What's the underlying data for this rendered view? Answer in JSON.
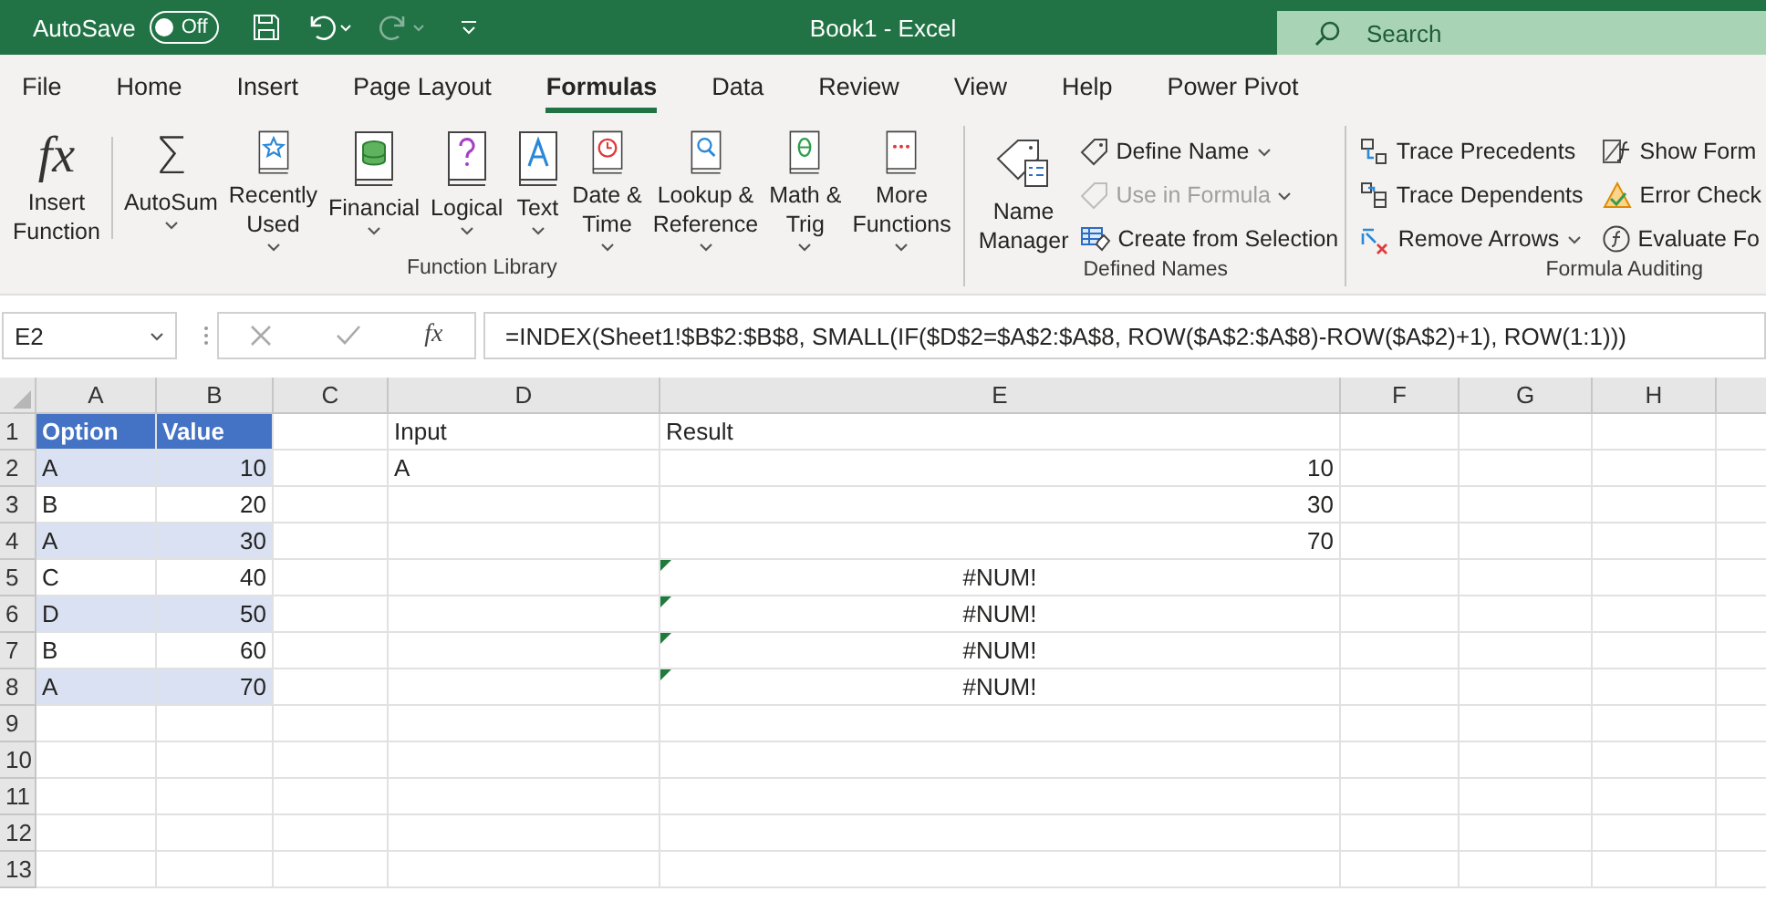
{
  "window": {
    "autosave_label": "AutoSave",
    "autosave_toggle": {
      "label": "Off",
      "on": false
    },
    "title": "Book1  -  Excel",
    "search": {
      "placeholder": "Search"
    }
  },
  "tabs": [
    {
      "label": "File",
      "selected": false
    },
    {
      "label": "Home",
      "selected": false
    },
    {
      "label": "Insert",
      "selected": false
    },
    {
      "label": "Page Layout",
      "selected": false
    },
    {
      "label": "Formulas",
      "selected": true
    },
    {
      "label": "Data",
      "selected": false
    },
    {
      "label": "Review",
      "selected": false
    },
    {
      "label": "View",
      "selected": false
    },
    {
      "label": "Help",
      "selected": false
    },
    {
      "label": "Power Pivot",
      "selected": false
    }
  ],
  "ribbon": {
    "function_library": {
      "label": "Function Library",
      "insert_function": {
        "glyph": "fx",
        "lines": [
          "Insert",
          "Function"
        ]
      },
      "buttons": [
        {
          "glyph": "Σ",
          "lines": [
            "AutoSum"
          ],
          "dropdown": true
        },
        {
          "lines": [
            "Recently",
            "Used"
          ],
          "dropdown": true
        },
        {
          "lines": [
            "Financial"
          ],
          "dropdown": true
        },
        {
          "lines": [
            "Logical"
          ],
          "dropdown": true
        },
        {
          "lines": [
            "Text"
          ],
          "dropdown": true
        },
        {
          "lines": [
            "Date &",
            "Time"
          ],
          "dropdown": true
        },
        {
          "lines": [
            "Lookup &",
            "Reference"
          ],
          "dropdown": true
        },
        {
          "lines": [
            "Math &",
            "Trig"
          ],
          "dropdown": true
        },
        {
          "lines": [
            "More",
            "Functions"
          ],
          "dropdown": true
        }
      ]
    },
    "defined_names": {
      "label": "Defined Names",
      "name_manager": {
        "lines": [
          "Name",
          "Manager"
        ]
      },
      "items": [
        {
          "label": "Define Name",
          "dropdown": true,
          "disabled": false
        },
        {
          "label": "Use in Formula",
          "dropdown": true,
          "disabled": true
        },
        {
          "label": "Create from Selection",
          "dropdown": false,
          "disabled": false
        }
      ]
    },
    "formula_auditing": {
      "label": "Formula Auditing",
      "columns": [
        [
          {
            "label": "Trace Precedents",
            "dropdown": false
          },
          {
            "label": "Trace Dependents",
            "dropdown": false
          },
          {
            "label": "Remove Arrows",
            "dropdown": true
          }
        ],
        [
          {
            "label": "Show Form",
            "dropdown": false
          },
          {
            "label": "Error Check",
            "dropdown": false
          },
          {
            "label": "Evaluate Fo",
            "dropdown": false
          }
        ]
      ]
    }
  },
  "formula_bar": {
    "name_box": "E2",
    "fx": "fx",
    "formula": "=INDEX(Sheet1!$B$2:$B$8, SMALL(IF($D$2=$A$2:$A$8, ROW($A$2:$A$8)-ROW($A$2)+1), ROW(1:1)))"
  },
  "sheet": {
    "columns": [
      "A",
      "B",
      "C",
      "D",
      "E",
      "F",
      "G",
      "H"
    ],
    "rows": [
      {
        "header": "1",
        "cells": {
          "A": {
            "text": "Option",
            "kind": "table-header"
          },
          "B": {
            "text": "Value",
            "kind": "table-header"
          },
          "D": {
            "text": "Input",
            "kind": "text"
          },
          "E": {
            "text": "Result",
            "kind": "text"
          }
        }
      },
      {
        "header": "2",
        "cells": {
          "A": {
            "text": "A",
            "kind": "table-band"
          },
          "B": {
            "text": "10",
            "kind": "table-band-number"
          },
          "D": {
            "text": "A",
            "kind": "text"
          },
          "E": {
            "text": "10",
            "kind": "number"
          }
        }
      },
      {
        "header": "3",
        "cells": {
          "A": {
            "text": "B",
            "kind": "text"
          },
          "B": {
            "text": "20",
            "kind": "number"
          },
          "E": {
            "text": "30",
            "kind": "number"
          }
        }
      },
      {
        "header": "4",
        "cells": {
          "A": {
            "text": "A",
            "kind": "table-band"
          },
          "B": {
            "text": "30",
            "kind": "table-band-number"
          },
          "E": {
            "text": "70",
            "kind": "number"
          }
        }
      },
      {
        "header": "5",
        "cells": {
          "A": {
            "text": "C",
            "kind": "text"
          },
          "B": {
            "text": "40",
            "kind": "number"
          },
          "E": {
            "text": "#NUM!",
            "kind": "error"
          }
        }
      },
      {
        "header": "6",
        "cells": {
          "A": {
            "text": "D",
            "kind": "table-band"
          },
          "B": {
            "text": "50",
            "kind": "table-band-number"
          },
          "E": {
            "text": "#NUM!",
            "kind": "error"
          }
        }
      },
      {
        "header": "7",
        "cells": {
          "A": {
            "text": "B",
            "kind": "text"
          },
          "B": {
            "text": "60",
            "kind": "number"
          },
          "E": {
            "text": "#NUM!",
            "kind": "error"
          }
        }
      },
      {
        "header": "8",
        "cells": {
          "A": {
            "text": "A",
            "kind": "table-band"
          },
          "B": {
            "text": "70",
            "kind": "table-band-number"
          },
          "E": {
            "text": "#NUM!",
            "kind": "error"
          }
        }
      },
      {
        "header": "9"
      },
      {
        "header": "10"
      },
      {
        "header": "11"
      },
      {
        "header": "12"
      },
      {
        "header": "13"
      }
    ]
  }
}
